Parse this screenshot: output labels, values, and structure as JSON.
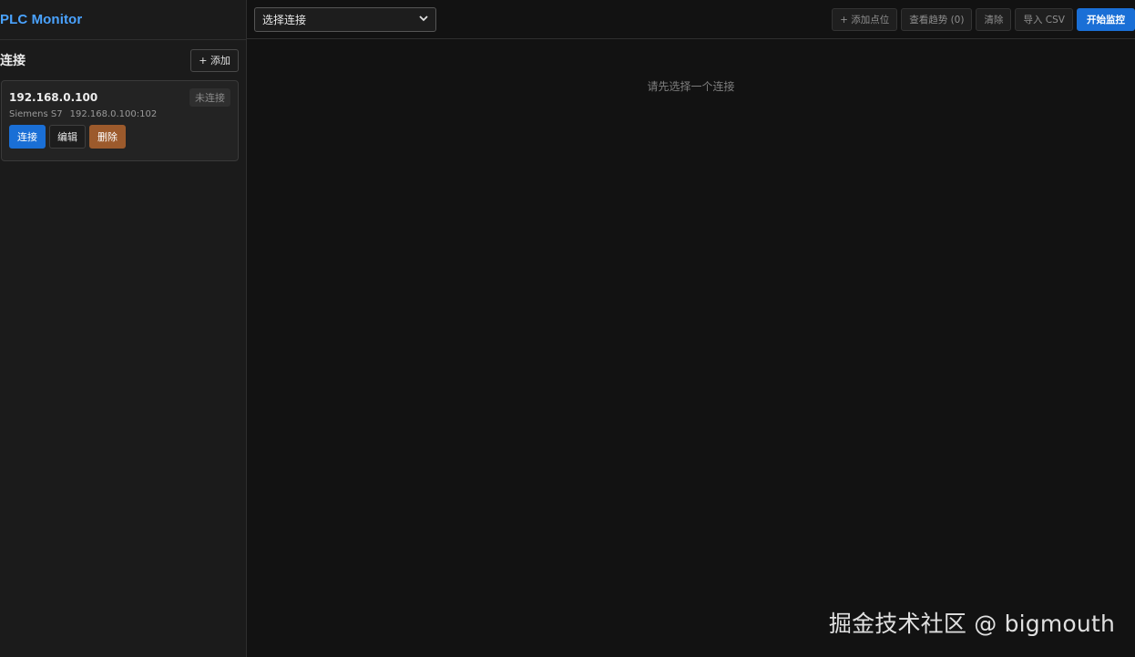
{
  "app": {
    "title": "PLC Monitor"
  },
  "sidebar": {
    "section_title": "连接",
    "add_label": "+ 添加",
    "connections": [
      {
        "ip": "192.168.0.100",
        "status": "未连接",
        "type": "Siemens S7",
        "address": "192.168.0.100:102",
        "connect_label": "连接",
        "edit_label": "编辑",
        "delete_label": "删除"
      }
    ]
  },
  "toolbar": {
    "select_value": "选择连接",
    "add_point_label": "+ 添加点位",
    "view_trend_label": "查看趋势 (0)",
    "clear_label": "清除",
    "import_csv_label": "导入 CSV",
    "start_monitor_label": "开始监控"
  },
  "main": {
    "empty_message": "请先选择一个连接"
  },
  "watermark": {
    "text": "掘金技术社区 @ bigmouth"
  },
  "colors": {
    "accent": "#1a6fd6",
    "brand": "#4aa3ff",
    "danger": "#9c5a2c",
    "background": "#121212",
    "sidebar_bg": "#1b1b1b"
  }
}
